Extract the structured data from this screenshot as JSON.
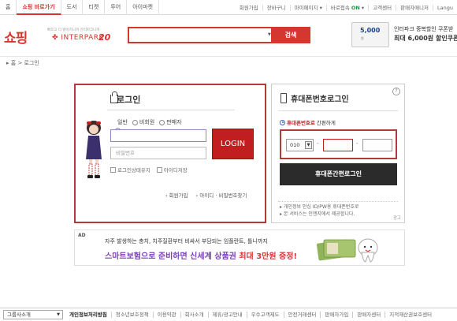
{
  "topnav": {
    "tabs": [
      "홈",
      "쇼핑 바로가기",
      "도서",
      "티켓",
      "투어",
      "아이마켓"
    ],
    "active_index": 1,
    "util": [
      "회원가입",
      "장바구니",
      "마이페이지",
      "바로접속",
      "고객센터",
      "판매자매니저",
      "Langu"
    ],
    "util_on": "ON"
  },
  "header": {
    "logo_kr": "쇼핑",
    "logo_sub": "빠르고 더 밝아지니까 인터파크니까",
    "logo_brand": "INTERPARK",
    "logo_20": "20",
    "search_placeholder": "",
    "search_button": "검색",
    "coupon_amount": "5,000",
    "coupon_sub": "원",
    "ad_text1": "인터파크 중복할인 쿠폰받",
    "ad_text2": "최대 6,000원 할인쿠폰"
  },
  "breadcrumb": [
    "홈",
    "로그인"
  ],
  "login": {
    "title": "로그인",
    "radios": [
      "일반",
      "비회원",
      "판매자"
    ],
    "radio_selected": 0,
    "id_placeholder": "",
    "pw_placeholder": "비밀번호",
    "login_button": "LOGIN",
    "checks": [
      "로그인상태유지",
      "아이디저장"
    ],
    "links": [
      "회원가입",
      "아이디 · 비밀번호찾기"
    ]
  },
  "phone_login": {
    "title": "휴대폰번호로그인",
    "help": "?",
    "radio_highlight": "휴대폰번호로",
    "radio_rest": "간편하게",
    "area_code": "010",
    "button": "휴대폰간편로그인",
    "notes": [
      "개인정보 안심 ID/PW용 휴대폰번호로",
      "본 서비스는 인앤지에서 제공합니다."
    ],
    "ad_label": "광고"
  },
  "ad_banner": {
    "label": "AD",
    "line1": "자주 발생하는 충치, 치주질환부터 비싸서 부담되는 임플란트, 틀니까지",
    "line2_a": "스마트보험으로 준비하면 신세계 상품권 ",
    "line2_b": "최대 3만원 증정!"
  },
  "footer": {
    "group_select": "그룹사소개",
    "links": [
      "개인정보처리방침",
      "청소년보호정책",
      "이용약관",
      "회사소개",
      "제휴/광고안내",
      "우수고객제도",
      "안전거래센터",
      "판매자가입",
      "판매자센터",
      "지적재산권보호센터"
    ]
  },
  "colors": {
    "brand_red": "#d3372e",
    "login_red": "#c11f1f",
    "ad_purple": "#7b3fb8",
    "phone_button": "#2b2b2b"
  }
}
